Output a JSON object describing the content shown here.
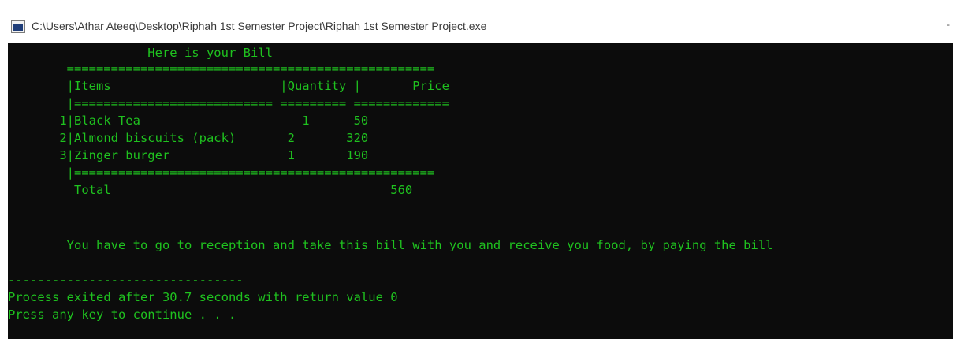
{
  "window": {
    "title": "C:\\Users\\Athar Ateeq\\Desktop\\Riphah 1st Semester Project\\Riphah 1st Semester Project.exe",
    "minimize_glyph": "-"
  },
  "console": {
    "colors": {
      "background": "#0c0c0c",
      "text": "#1fc21f"
    },
    "lines": [
      "                   Here is your Bill",
      "        ==================================================",
      "        |Items                       |Quantity |       Price",
      "        |=========================== ========= =============",
      "       1|Black Tea                      1      50",
      "       2|Almond biscuits (pack)       2       320",
      "       3|Zinger burger                1       190",
      "        |=================================================",
      "         Total                                      560",
      "",
      "",
      "",
      "        You have to go to reception and take this bill with you and receive you food, by paying the bill",
      "",
      "--------------------------------",
      "Process exited after 30.7 seconds with return value 0",
      "Press any key to continue . . ."
    ]
  }
}
